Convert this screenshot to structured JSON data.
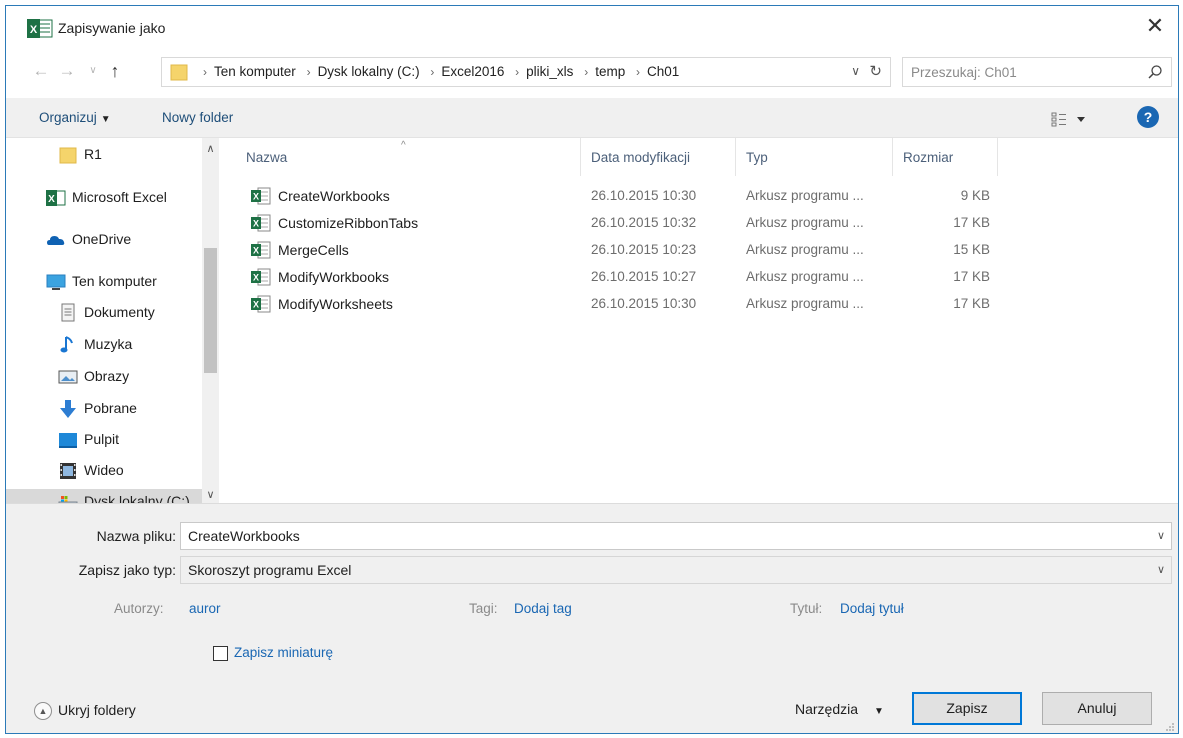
{
  "window": {
    "title": "Zapisywanie jako",
    "app_icon": "excel-icon",
    "close": "✕"
  },
  "navigation": {
    "crumbs": [
      "Ten komputer",
      "Dysk lokalny (C:)",
      "Excel2016",
      "pliki_xls",
      "temp",
      "Ch01"
    ],
    "search_placeholder": "Przeszukaj: Ch01"
  },
  "toolbar": {
    "organize": "Organizuj",
    "new_folder": "Nowy folder",
    "help": "?"
  },
  "sidebar": {
    "items": [
      {
        "label": "R1",
        "icon": "folder-icon",
        "indent": 1,
        "selected": false
      },
      {
        "label": "Microsoft Excel",
        "icon": "excel-icon",
        "indent": 0,
        "selected": false
      },
      {
        "label": "OneDrive",
        "icon": "cloud-icon",
        "indent": 0,
        "selected": false
      },
      {
        "label": "Ten komputer",
        "icon": "computer-icon",
        "indent": 0,
        "selected": false
      },
      {
        "label": "Dokumenty",
        "icon": "documents-icon",
        "indent": 1,
        "selected": false
      },
      {
        "label": "Muzyka",
        "icon": "music-icon",
        "indent": 1,
        "selected": false
      },
      {
        "label": "Obrazy",
        "icon": "pictures-icon",
        "indent": 1,
        "selected": false
      },
      {
        "label": "Pobrane",
        "icon": "download-icon",
        "indent": 1,
        "selected": false
      },
      {
        "label": "Pulpit",
        "icon": "desktop-icon",
        "indent": 1,
        "selected": false
      },
      {
        "label": "Wideo",
        "icon": "video-icon",
        "indent": 1,
        "selected": false
      },
      {
        "label": "Dysk lokalny (C:)",
        "icon": "drive-icon",
        "indent": 1,
        "selected": true
      }
    ]
  },
  "file_list": {
    "columns": [
      "Nazwa",
      "Data modyfikacji",
      "Typ",
      "Rozmiar"
    ],
    "rows": [
      {
        "name": "CreateWorkbooks",
        "date": "26.10.2015 10:30",
        "type": "Arkusz programu ...",
        "size": "9 KB"
      },
      {
        "name": "CustomizeRibbonTabs",
        "date": "26.10.2015 10:32",
        "type": "Arkusz programu ...",
        "size": "17 KB"
      },
      {
        "name": "MergeCells",
        "date": "26.10.2015 10:23",
        "type": "Arkusz programu ...",
        "size": "15 KB"
      },
      {
        "name": "ModifyWorkbooks",
        "date": "26.10.2015 10:27",
        "type": "Arkusz programu ...",
        "size": "17 KB"
      },
      {
        "name": "ModifyWorksheets",
        "date": "26.10.2015 10:30",
        "type": "Arkusz programu ...",
        "size": "17 KB"
      }
    ]
  },
  "form": {
    "filename_label": "Nazwa pliku:",
    "filename_value": "CreateWorkbooks",
    "type_label": "Zapisz jako typ:",
    "type_value": "Skoroszyt programu Excel",
    "authors_label": "Autorzy:",
    "authors_value": "auror",
    "tags_label": "Tagi:",
    "tags_value": "Dodaj tag",
    "title_label": "Tytuł:",
    "title_value": "Dodaj tytuł",
    "thumbnail_label": "Zapisz miniaturę",
    "thumbnail_checked": false
  },
  "footer": {
    "hide_folders": "Ukryj foldery",
    "tools": "Narzędzia",
    "save": "Zapisz",
    "cancel": "Anuluj"
  },
  "colors": {
    "accent": "#0078d7",
    "link": "#1a67b3",
    "excel_green": "#1e7145",
    "folder_yellow": "#f5d46b"
  }
}
